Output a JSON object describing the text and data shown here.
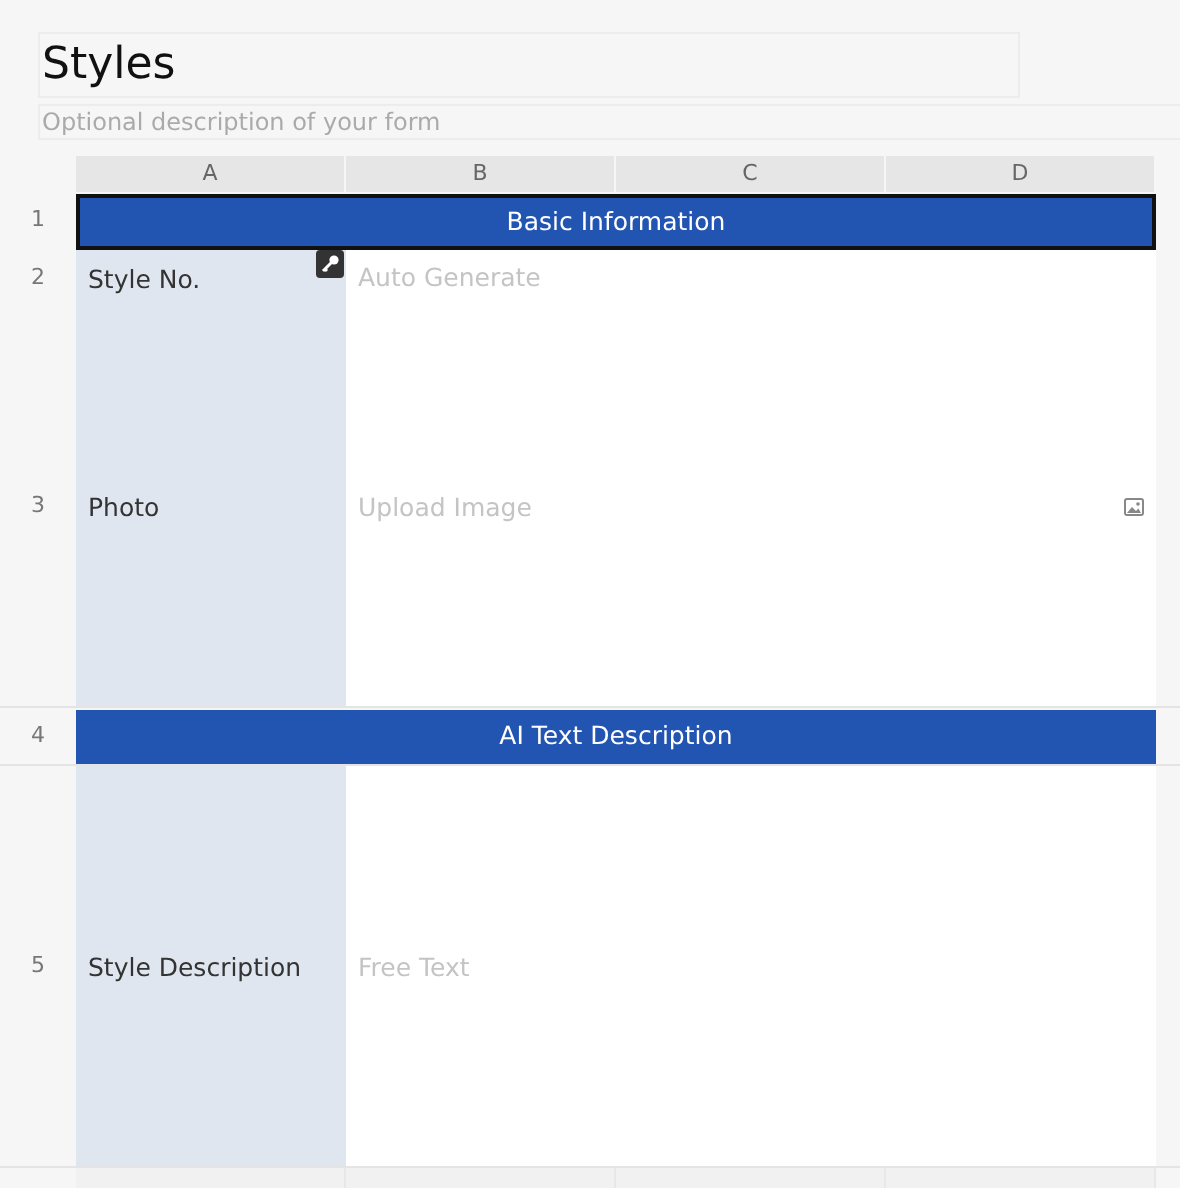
{
  "form": {
    "title": "Styles",
    "description_placeholder": "Optional description of your form"
  },
  "columns": [
    "A",
    "B",
    "C",
    "D"
  ],
  "rows": [
    {
      "number": "1",
      "kind": "section",
      "title": "Basic Information",
      "selected": true
    },
    {
      "number": "2",
      "kind": "auto",
      "label": "Style No.",
      "placeholder": "Auto Generate",
      "tall": false
    },
    {
      "number": "3",
      "kind": "image",
      "label": "Photo",
      "placeholder": "Upload Image",
      "tall": true
    },
    {
      "number": "4",
      "kind": "section",
      "title": "AI Text Description",
      "selected": false
    },
    {
      "number": "5",
      "kind": "text",
      "label": "Style Description",
      "placeholder": "Free Text",
      "tall": true
    }
  ]
}
